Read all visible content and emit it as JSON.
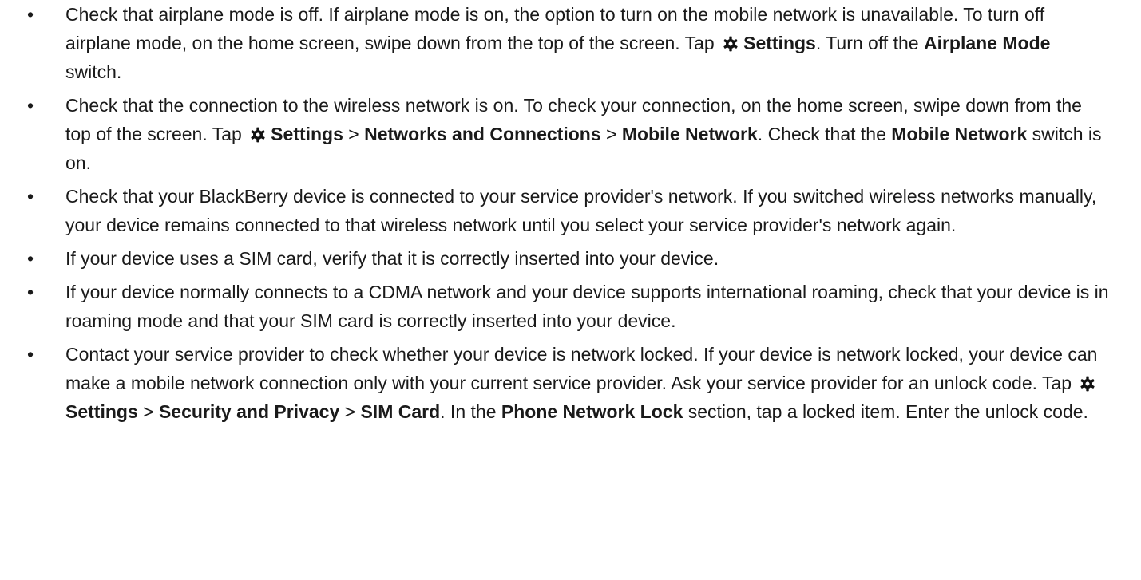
{
  "bullet_char": "•",
  "items": [
    {
      "parts": [
        {
          "t": "Check that airplane mode is off. If airplane mode is on, the option to turn on the mobile network is unavailable. To turn off airplane mode, on the home screen, swipe down from the top of the screen. Tap "
        },
        {
          "icon": "gear-icon"
        },
        {
          "b": "Settings"
        },
        {
          "t": ". Turn off the "
        },
        {
          "b": "Airplane Mode"
        },
        {
          "t": " switch."
        }
      ]
    },
    {
      "parts": [
        {
          "t": "Check that the connection to the wireless network is on. To check your connection, on the home screen, swipe down from the top of the screen. Tap "
        },
        {
          "icon": "gear-icon"
        },
        {
          "b": "Settings"
        },
        {
          "t": " > "
        },
        {
          "b": "Networks and Connections"
        },
        {
          "t": " > "
        },
        {
          "b": "Mobile Network"
        },
        {
          "t": ". Check that the "
        },
        {
          "b": "Mobile Network"
        },
        {
          "t": " switch is on."
        }
      ]
    },
    {
      "parts": [
        {
          "t": "Check that your BlackBerry device is connected to your service provider's network. If you switched wireless networks manually, your device remains connected to that wireless network until you select your service provider's network again."
        }
      ]
    },
    {
      "parts": [
        {
          "t": "If your device uses a SIM card, verify that it is correctly inserted into your device."
        }
      ]
    },
    {
      "parts": [
        {
          "t": "If your device normally connects to a CDMA network and your device supports international roaming, check that your device is in roaming mode and that your SIM card is correctly inserted into your device."
        }
      ]
    },
    {
      "parts": [
        {
          "t": "Contact your service provider to check whether your device is network locked. If your device is network locked, your device can make a mobile network connection only with your current service provider. Ask your service provider for an unlock code. Tap "
        },
        {
          "icon": "gear-icon"
        },
        {
          "b": "Settings"
        },
        {
          "t": " > "
        },
        {
          "b": "Security and Privacy"
        },
        {
          "t": " > "
        },
        {
          "b": "SIM Card"
        },
        {
          "t": ". In the "
        },
        {
          "b": "Phone Network Lock"
        },
        {
          "t": " section, tap a locked item. Enter the unlock code."
        }
      ]
    }
  ]
}
